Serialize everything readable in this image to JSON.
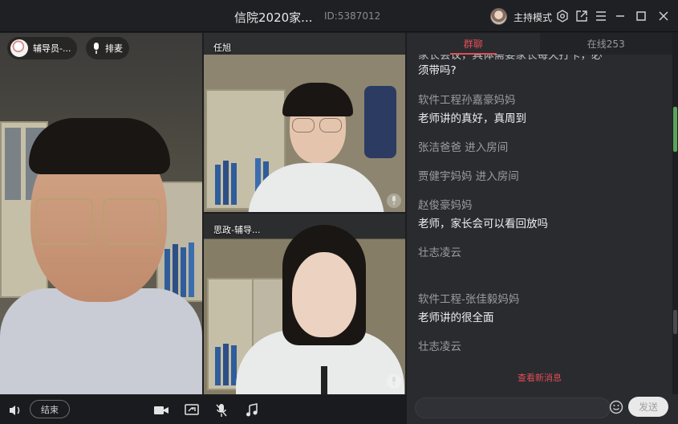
{
  "window": {
    "title": "信院2020家...",
    "room_id": "ID:5387012",
    "host_mode_label": "主持模式"
  },
  "videos": {
    "main": {
      "name": "辅导员-...",
      "queue_label": "排麦"
    },
    "tile_a": {
      "name": "任旭"
    },
    "tile_b": {
      "name": "思政-辅导..."
    }
  },
  "controls": {
    "end_label": "结束"
  },
  "chat": {
    "tabs": [
      {
        "label": "群聊",
        "active": true
      },
      {
        "label": "在线253",
        "active": false
      }
    ],
    "clipped_top_line": "家长会议，具体需要家长每天打卡，必",
    "first_text": "须带吗?",
    "messages": [
      {
        "sender": "软件工程孙嘉豪妈妈",
        "text": "老师讲的真好，真周到"
      },
      {
        "join": "张洁爸爸 进入房间"
      },
      {
        "join": "贾健宇妈妈 进入房间"
      },
      {
        "sender": "赵俊豪妈妈",
        "text": "老师，家长会可以看回放吗"
      },
      {
        "sender": "壮志凌云",
        "text": ""
      },
      {
        "sender": "软件工程-张佳毅妈妈",
        "text": "老师讲的很全面"
      },
      {
        "sender": "壮志凌云",
        "text": ""
      }
    ],
    "new_messages_label": "查看新消息",
    "input_placeholder": "",
    "send_label": "发送"
  },
  "colors": {
    "accent": "#e04e55",
    "panel": "#2a2b2f",
    "titlebar": "#1f2023"
  }
}
